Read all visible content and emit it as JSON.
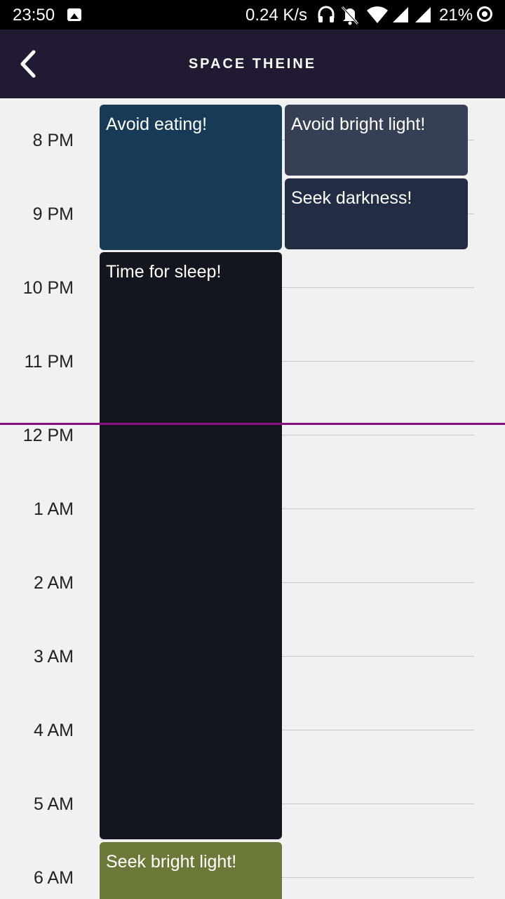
{
  "status_bar": {
    "time": "23:50",
    "net_speed": "0.24 K/s",
    "battery": "21%",
    "icons": [
      "image-icon",
      "headphones-icon",
      "bell-off-icon",
      "wifi-icon",
      "signal-icon",
      "signal-icon",
      "battery-ring-icon"
    ]
  },
  "app_bar": {
    "title": "SPACE THEINE",
    "back_icon": "back-arrow-icon"
  },
  "timeline": {
    "hours": [
      "8 PM",
      "9 PM",
      "10 PM",
      "11 PM",
      "12 PM",
      "1 AM",
      "2 AM",
      "3 AM",
      "4 AM",
      "5 AM",
      "6 AM"
    ],
    "events": {
      "avoid_eating": {
        "label": "Avoid eating!",
        "color": "#173a57"
      },
      "avoid_bright_light": {
        "label": "Avoid bright light!",
        "color": "#363f54"
      },
      "seek_darkness": {
        "label": "Seek darkness!",
        "color": "#222c42"
      },
      "time_for_sleep": {
        "label": "Time for sleep!",
        "color": "#13161e"
      },
      "seek_bright_light": {
        "label": "Seek bright light!",
        "color": "#6b7938"
      }
    },
    "now_line_color": "#8b0f86"
  }
}
